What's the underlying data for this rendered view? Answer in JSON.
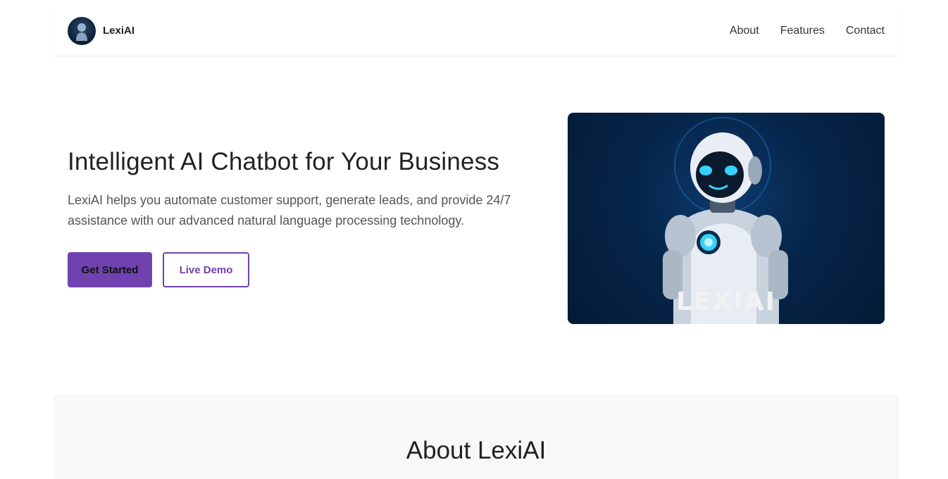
{
  "brand": {
    "name": "LexiAI",
    "logo_icon": "robot-logo-icon"
  },
  "nav": {
    "items": [
      {
        "label": "About"
      },
      {
        "label": "Features"
      },
      {
        "label": "Contact"
      }
    ]
  },
  "hero": {
    "title": "Intelligent AI Chatbot for Your Business",
    "subtitle": "LexiAI helps you automate customer support, generate leads, and provide 24/7 assistance with our advanced natural language processing technology.",
    "primary_button": "Get Started",
    "secondary_button": "Live Demo",
    "image_label": "LEXIAI",
    "image_icon": "robot-illustration"
  },
  "about": {
    "title": "About LexiAI"
  },
  "colors": {
    "accent": "#6f42b0",
    "hero_image_bg": "#041a35",
    "about_bg": "#f8f8f8",
    "robot_eye": "#36d1ff"
  }
}
